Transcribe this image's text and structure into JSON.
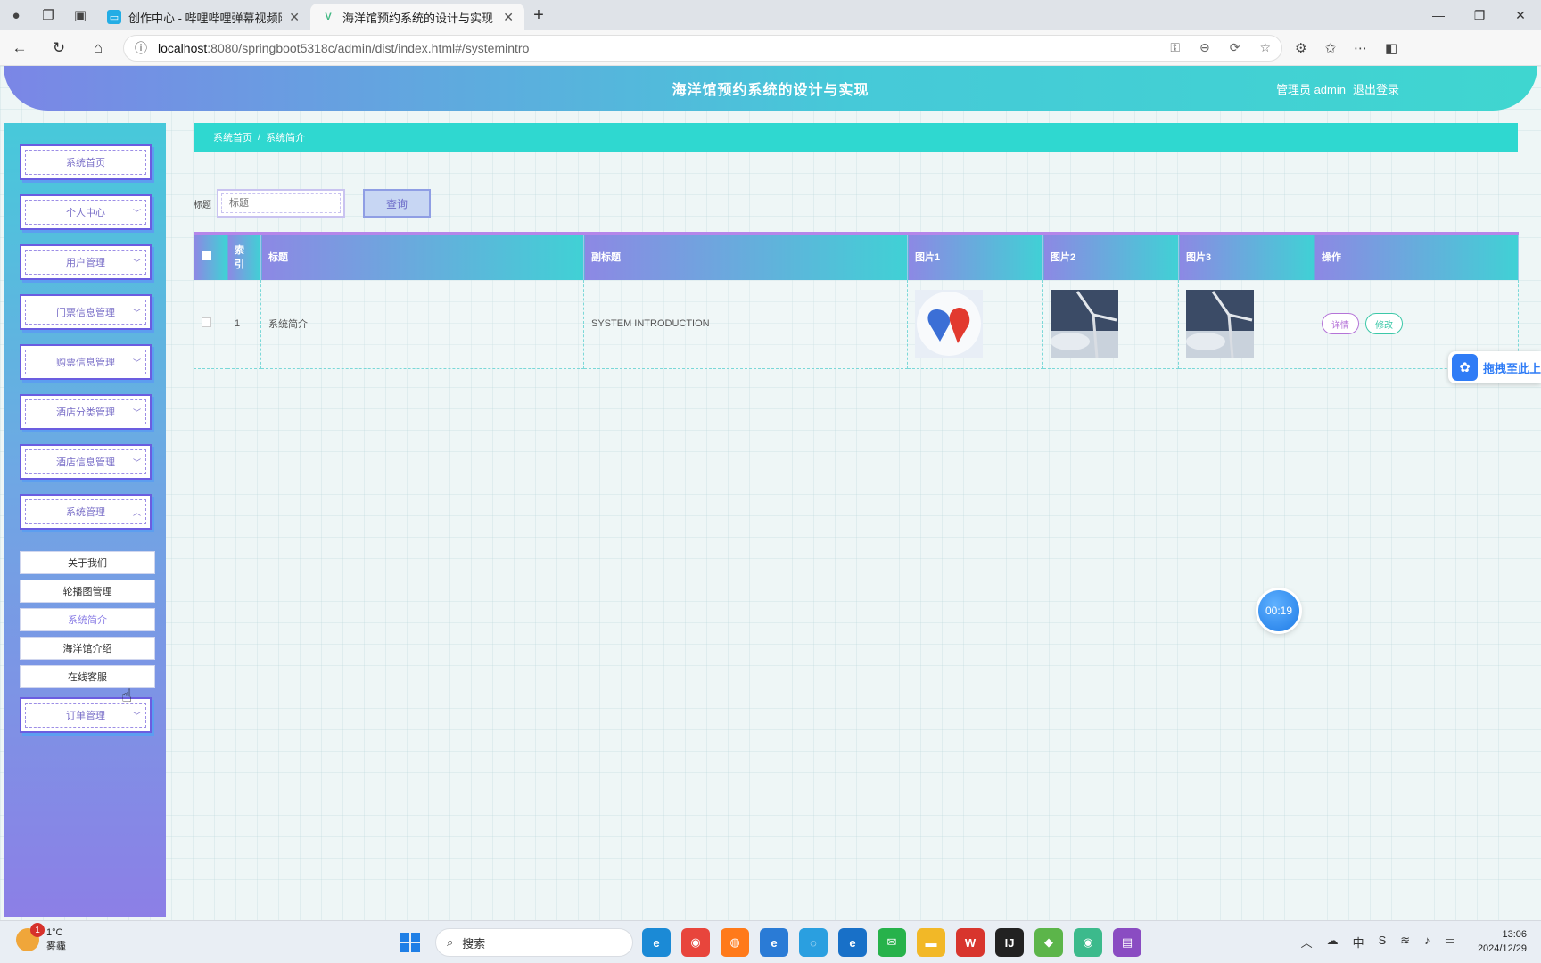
{
  "browser": {
    "tabs": [
      {
        "title": "创作中心 - 哔哩哔哩弹幕视频网",
        "active": false
      },
      {
        "title": "海洋馆预约系统的设计与实现",
        "active": true
      }
    ],
    "url_host": "localhost",
    "url_path": ":8080/springboot5318c/admin/dist/index.html#/systemintro"
  },
  "header": {
    "title": "海洋馆预约系统的设计与实现",
    "user": "管理员 admin",
    "logout": "退出登录"
  },
  "sidebar": {
    "menu": [
      {
        "label": "系统首页",
        "chevron": ""
      },
      {
        "label": "个人中心",
        "chevron": "﹀"
      },
      {
        "label": "用户管理",
        "chevron": "﹀"
      },
      {
        "label": "门票信息管理",
        "chevron": "﹀"
      },
      {
        "label": "购票信息管理",
        "chevron": "﹀"
      },
      {
        "label": "酒店分类管理",
        "chevron": "﹀"
      },
      {
        "label": "酒店信息管理",
        "chevron": "﹀"
      },
      {
        "label": "系统管理",
        "chevron": "︿"
      },
      {
        "label": "订单管理",
        "chevron": "﹀"
      }
    ],
    "submenu": [
      {
        "label": "关于我们"
      },
      {
        "label": "轮播图管理"
      },
      {
        "label": "系统简介"
      },
      {
        "label": "海洋馆介绍"
      },
      {
        "label": "在线客服"
      }
    ]
  },
  "breadcrumb": {
    "home": "系统首页",
    "separator": "/",
    "current": "系统简介"
  },
  "search": {
    "label": "标题",
    "placeholder": "标题",
    "button": "查询"
  },
  "table": {
    "headers": {
      "index": "索引",
      "title": "标题",
      "subtitle": "副标题",
      "pic1": "图片1",
      "pic2": "图片2",
      "pic3": "图片3",
      "actions": "操作"
    },
    "rows": [
      {
        "index": "1",
        "title": "系统简介",
        "subtitle": "SYSTEM INTRODUCTION",
        "detail": "详情",
        "edit": "修改"
      }
    ]
  },
  "overlay": {
    "timer": "00:19",
    "drag_text": "拖拽至此上"
  },
  "taskbar": {
    "weather_temp": "1°C",
    "weather_desc": "雾霾",
    "weather_badge": "1",
    "search": "搜索",
    "time": "13:06",
    "date": "2024/12/29"
  }
}
